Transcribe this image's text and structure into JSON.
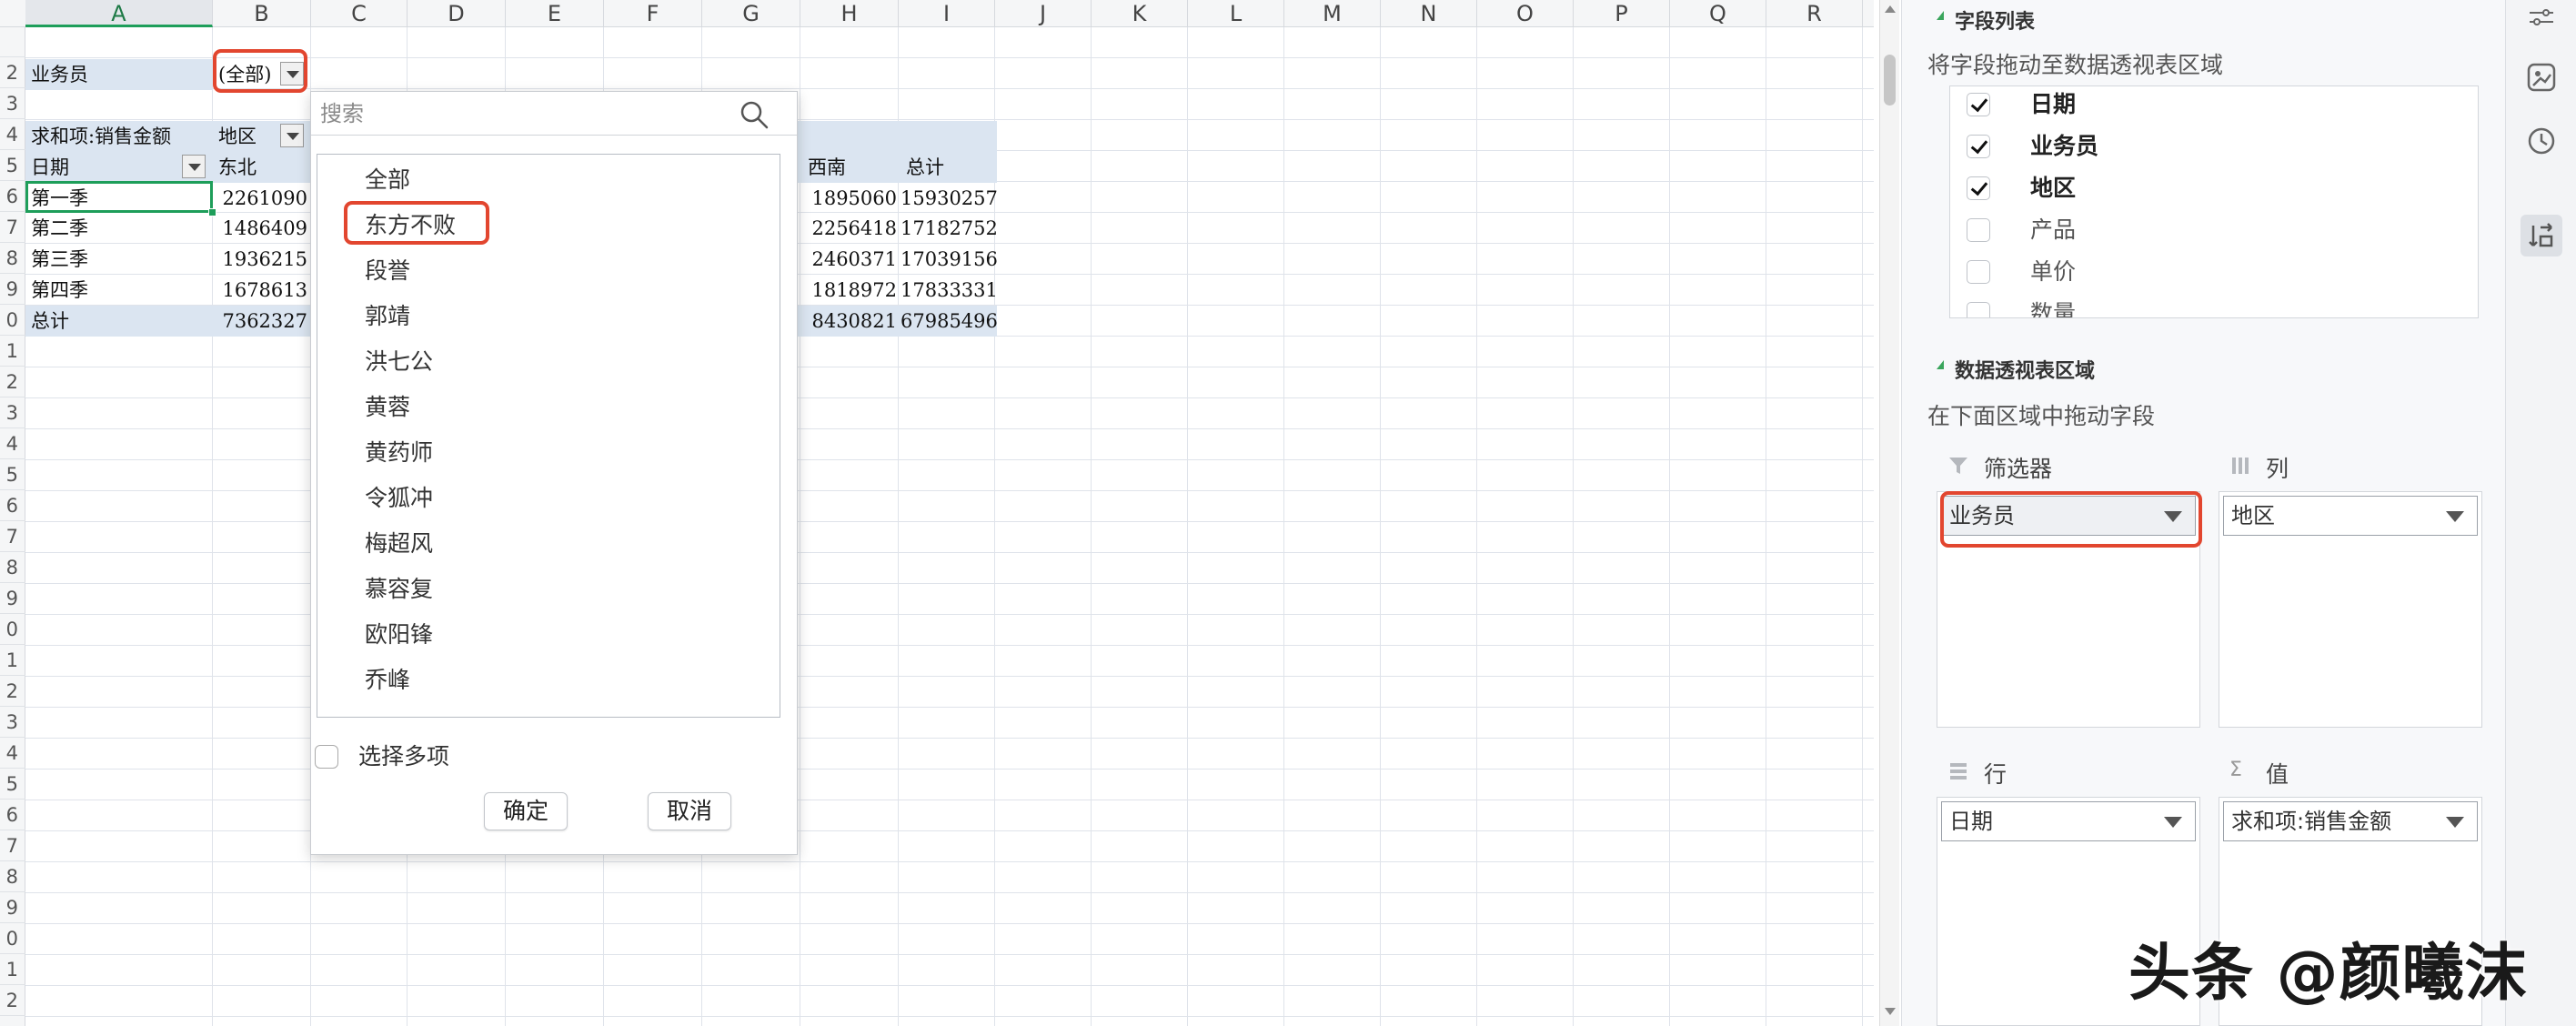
{
  "sheet": {
    "columns": [
      "A",
      "B",
      "C",
      "D",
      "E",
      "F",
      "G",
      "H",
      "I",
      "J",
      "K",
      "L",
      "M",
      "N",
      "O",
      "P",
      "Q",
      "R"
    ],
    "row_numbers": [
      "",
      "2",
      "3",
      "4",
      "5",
      "6",
      "7",
      "8",
      "9",
      "0",
      "1",
      "2",
      "3",
      "4",
      "5",
      "6",
      "7",
      "8",
      "9",
      "0",
      "1",
      "2",
      "3",
      "4",
      "5",
      "6",
      "7",
      "8",
      "9",
      "0",
      "1",
      "2"
    ],
    "filter_label": "业务员",
    "filter_value": "(全部)",
    "pivot_header": "求和项:销售金额",
    "column_field": "地区",
    "row_field": "日期",
    "col_labels": [
      "东北",
      "西南",
      "总计"
    ],
    "rows": [
      {
        "label": "第一季",
        "b": "2261090",
        "h": "1895060",
        "i": "15930257"
      },
      {
        "label": "第二季",
        "b": "1486409",
        "h": "2256418",
        "i": "17182752"
      },
      {
        "label": "第三季",
        "b": "1936215",
        "h": "2460371",
        "i": "17039156"
      },
      {
        "label": "第四季",
        "b": "1678613",
        "h": "1818972",
        "i": "17833331"
      }
    ],
    "total": {
      "label": "总计",
      "b": "7362327",
      "h": "8430821",
      "i": "67985496"
    }
  },
  "filter_popup": {
    "search_placeholder": "搜索",
    "items": [
      "全部",
      "东方不败",
      "段誉",
      "郭靖",
      "洪七公",
      "黄蓉",
      "黄药师",
      "令狐冲",
      "梅超风",
      "慕容复",
      "欧阳锋",
      "乔峰"
    ],
    "multi_select_label": "选择多项",
    "ok_label": "确定",
    "cancel_label": "取消"
  },
  "panel": {
    "field_list_title": "字段列表",
    "field_list_hint": "将字段拖动至数据透视表区域",
    "fields": [
      {
        "name": "日期",
        "checked": true
      },
      {
        "name": "业务员",
        "checked": true
      },
      {
        "name": "地区",
        "checked": true
      },
      {
        "name": "产品",
        "checked": false
      },
      {
        "name": "单价",
        "checked": false
      },
      {
        "name": "数量",
        "checked": false
      }
    ],
    "areas_title": "数据透视表区域",
    "areas_hint": "在下面区域中拖动字段",
    "filters_label": "筛选器",
    "filters_value": "业务员",
    "columns_label": "列",
    "columns_value": "地区",
    "rows_label": "行",
    "rows_value": "日期",
    "values_label": "值",
    "values_value": "求和项:销售金额"
  },
  "icons": [
    "pivot-settings-icon",
    "chart-icon",
    "history-icon",
    "field-swap-icon"
  ],
  "watermark": "头条 @颜曦沫",
  "colors": {
    "accent_green": "#1e9e5a",
    "highlight_red": "#e2462f",
    "pivot_band": "#dbe5f1"
  }
}
